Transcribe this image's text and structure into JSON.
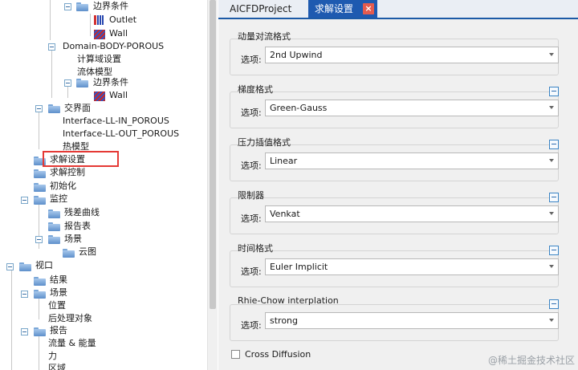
{
  "tree": [
    {
      "label": "边界条件",
      "icon": "folder-icon",
      "toggle": true
    },
    {
      "label": "Outlet",
      "icon": "outlet-icon",
      "toggle": false
    },
    {
      "label": "Wall",
      "icon": "wall-icon",
      "toggle": false
    },
    {
      "label": "Domain-BODY-POROUS",
      "icon": "",
      "toggle": true
    },
    {
      "label": "计算域设置",
      "icon": "",
      "toggle": false
    },
    {
      "label": "流体模型",
      "icon": "",
      "toggle": false
    },
    {
      "label": "边界条件",
      "icon": "folder-icon",
      "toggle": true
    },
    {
      "label": "Wall",
      "icon": "wall-icon",
      "toggle": false
    },
    {
      "label": "交界面",
      "icon": "folder-icon",
      "toggle": true
    },
    {
      "label": "Interface-LL-IN_POROUS",
      "icon": "",
      "toggle": false
    },
    {
      "label": "Interface-LL-OUT_POROUS",
      "icon": "",
      "toggle": false
    },
    {
      "label": "热模型",
      "icon": "",
      "toggle": false
    },
    {
      "label": "求解设置",
      "icon": "folder-icon",
      "toggle": false
    },
    {
      "label": "求解控制",
      "icon": "folder-icon",
      "toggle": false
    },
    {
      "label": "初始化",
      "icon": "folder-icon",
      "toggle": false
    },
    {
      "label": "监控",
      "icon": "folder-icon",
      "toggle": true
    },
    {
      "label": "残差曲线",
      "icon": "folder-icon",
      "toggle": false
    },
    {
      "label": "报告表",
      "icon": "folder-icon",
      "toggle": false
    },
    {
      "label": "场景",
      "icon": "folder-icon",
      "toggle": true
    },
    {
      "label": "云图",
      "icon": "folder-icon",
      "toggle": false
    },
    {
      "label": "视口",
      "icon": "folder-icon",
      "toggle": true
    },
    {
      "label": "结果",
      "icon": "folder-icon",
      "toggle": false
    },
    {
      "label": "场景",
      "icon": "folder-icon",
      "toggle": true
    },
    {
      "label": "位置",
      "icon": "",
      "toggle": false
    },
    {
      "label": "后处理对象",
      "icon": "",
      "toggle": false
    },
    {
      "label": "报告",
      "icon": "folder-icon",
      "toggle": true
    },
    {
      "label": "流量 & 能量",
      "icon": "",
      "toggle": false
    },
    {
      "label": "力",
      "icon": "",
      "toggle": false
    },
    {
      "label": "区域",
      "icon": "",
      "toggle": false
    }
  ],
  "tabs": {
    "project": "AICFDProject",
    "active": "求解设置",
    "close": "×"
  },
  "groups": [
    {
      "title": "动量对流格式",
      "label": "选项:",
      "value": "2nd Upwind"
    },
    {
      "title": "梯度格式",
      "label": "选项:",
      "value": "Green-Gauss"
    },
    {
      "title": "压力插值格式",
      "label": "选项:",
      "value": "Linear"
    },
    {
      "title": "限制器",
      "label": "选项:",
      "value": "Venkat"
    },
    {
      "title": "时间格式",
      "label": "选项:",
      "value": "Euler Implicit"
    },
    {
      "title": "Rhie-Chow interplation",
      "label": "选项:",
      "value": "strong"
    }
  ],
  "cross_diffusion": {
    "label": "Cross Diffusion",
    "checked": false
  },
  "watermark": "@稀土掘金技术社区"
}
